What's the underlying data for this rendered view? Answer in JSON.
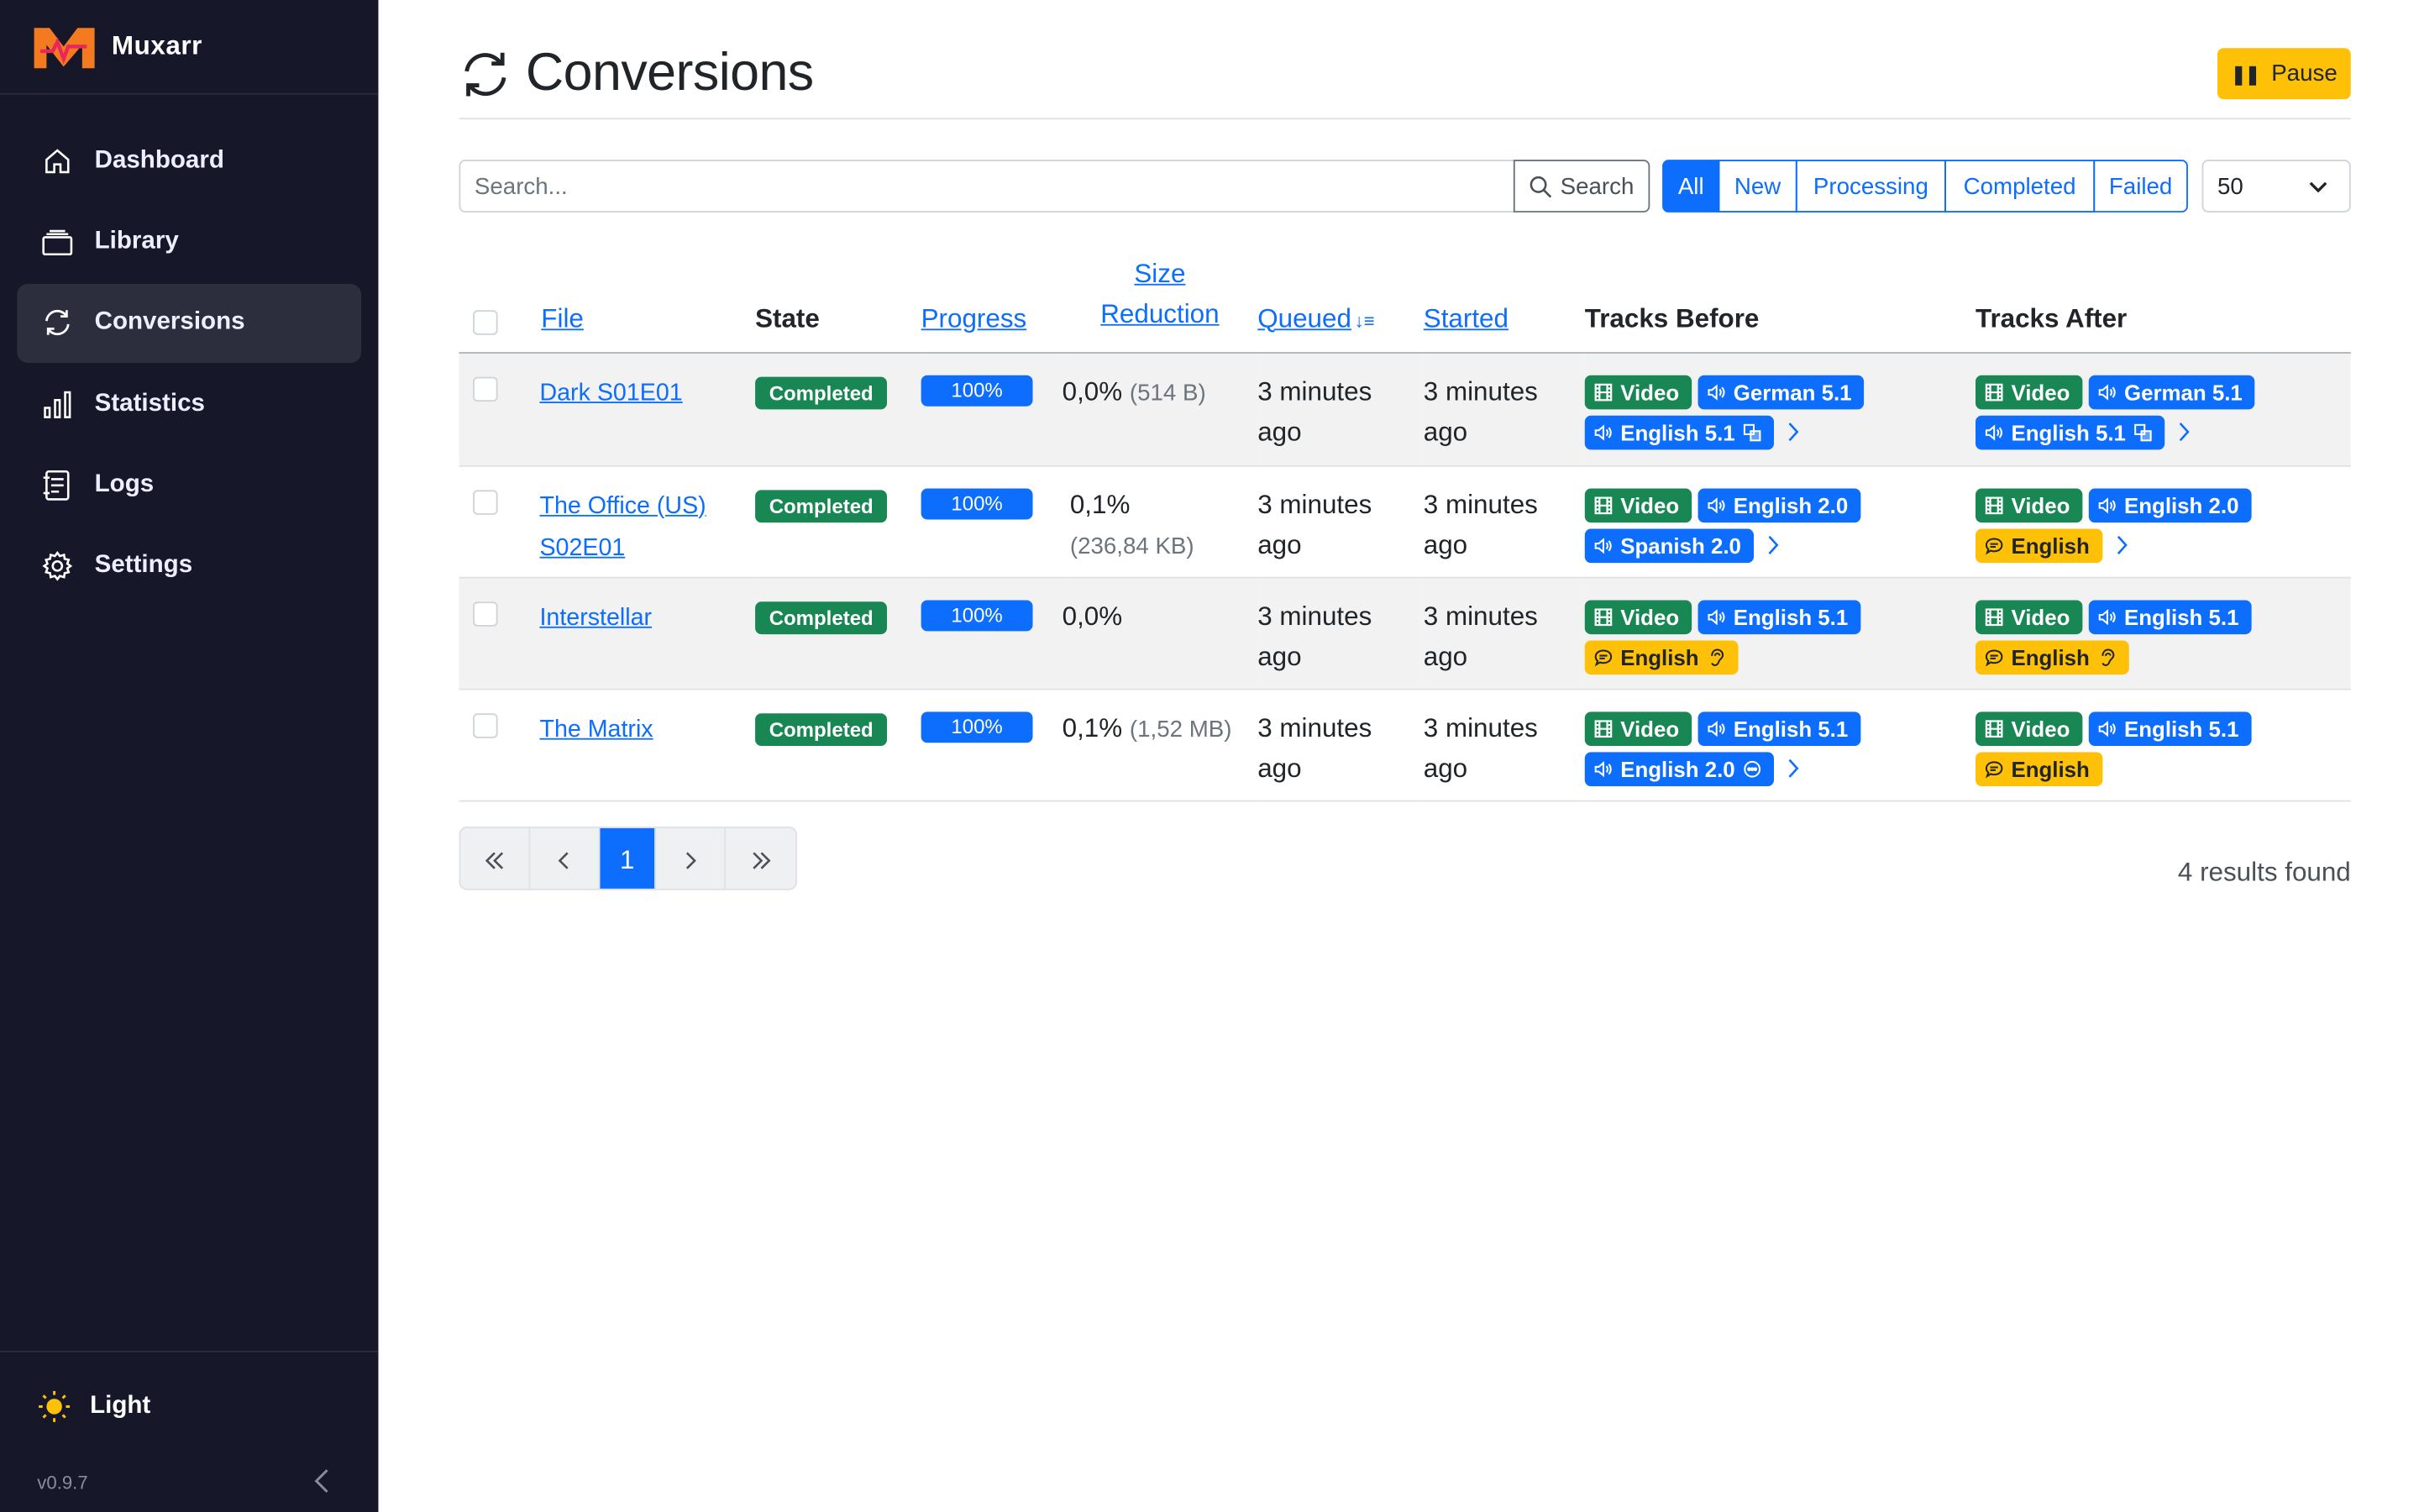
{
  "app": {
    "name": "Muxarr",
    "version": "v0.9.7",
    "theme_label": "Light"
  },
  "sidebar": {
    "items": [
      {
        "label": "Dashboard",
        "icon": "home-icon"
      },
      {
        "label": "Library",
        "icon": "library-icon"
      },
      {
        "label": "Conversions",
        "icon": "sync-icon",
        "active": true
      },
      {
        "label": "Statistics",
        "icon": "bar-chart-icon"
      },
      {
        "label": "Logs",
        "icon": "journal-icon"
      },
      {
        "label": "Settings",
        "icon": "gear-icon"
      }
    ]
  },
  "header": {
    "title": "Conversions",
    "pause_label": "Pause"
  },
  "toolbar": {
    "search_placeholder": "Search...",
    "search_button": "Search",
    "filters": [
      "All",
      "New",
      "Processing",
      "Completed",
      "Failed"
    ],
    "active_filter": "All",
    "page_size": "50"
  },
  "table": {
    "headers": {
      "file": "File",
      "state": "State",
      "progress": "Progress",
      "size_line1": "Size",
      "size_line2": "Reduction",
      "queued": "Queued",
      "started": "Started",
      "tracks_before": "Tracks Before",
      "tracks_after": "Tracks After"
    },
    "rows": [
      {
        "file_line1": "Dark S01E01",
        "file_line2": "",
        "state": "Completed",
        "progress": "100%",
        "size_pct": "0,0%",
        "size_abs": "(514 B)",
        "queued_1": "3 minutes",
        "queued_2": "ago",
        "started_1": "3 minutes",
        "started_2": "ago",
        "before": [
          {
            "type": "video",
            "label": "Video"
          },
          {
            "type": "audio",
            "label": "German 5.1"
          },
          {
            "type": "audio",
            "label": "English 5.1",
            "trail": "translate-icon"
          }
        ],
        "before_more": true,
        "after": [
          {
            "type": "video",
            "label": "Video"
          },
          {
            "type": "audio",
            "label": "German 5.1"
          },
          {
            "type": "audio",
            "label": "English 5.1",
            "trail": "translate-icon"
          }
        ],
        "after_more": true
      },
      {
        "file_line1": "The Office (US)",
        "file_line2": "S02E01",
        "state": "Completed",
        "progress": "100%",
        "size_pct": "0,1%",
        "size_abs": "(236,84 KB)",
        "queued_1": "3 minutes",
        "queued_2": "ago",
        "started_1": "3 minutes",
        "started_2": "ago",
        "before": [
          {
            "type": "video",
            "label": "Video"
          },
          {
            "type": "audio",
            "label": "English 2.0"
          },
          {
            "type": "audio",
            "label": "Spanish 2.0"
          }
        ],
        "before_more": true,
        "after": [
          {
            "type": "video",
            "label": "Video"
          },
          {
            "type": "audio",
            "label": "English 2.0"
          },
          {
            "type": "sub",
            "label": "English"
          }
        ],
        "after_more": true
      },
      {
        "file_line1": "Interstellar",
        "file_line2": "",
        "state": "Completed",
        "progress": "100%",
        "size_pct": "0,0%",
        "size_abs": "",
        "queued_1": "3 minutes",
        "queued_2": "ago",
        "started_1": "3 minutes",
        "started_2": "ago",
        "before": [
          {
            "type": "video",
            "label": "Video"
          },
          {
            "type": "audio",
            "label": "English 5.1"
          },
          {
            "type": "sub",
            "label": "English",
            "trail": "ear-icon"
          }
        ],
        "before_more": false,
        "after": [
          {
            "type": "video",
            "label": "Video"
          },
          {
            "type": "audio",
            "label": "English 5.1"
          },
          {
            "type": "sub",
            "label": "English",
            "trail": "ear-icon"
          }
        ],
        "after_more": false
      },
      {
        "file_line1": "The Matrix",
        "file_line2": "",
        "state": "Completed",
        "progress": "100%",
        "size_pct": "0,1%",
        "size_abs": "(1,52 MB)",
        "queued_1": "3 minutes",
        "queued_2": "ago",
        "started_1": "3 minutes",
        "started_2": "ago",
        "before": [
          {
            "type": "video",
            "label": "Video"
          },
          {
            "type": "audio",
            "label": "English 5.1"
          },
          {
            "type": "audio",
            "label": "English 2.0",
            "trail": "commentary-icon"
          }
        ],
        "before_more": true,
        "after": [
          {
            "type": "video",
            "label": "Video"
          },
          {
            "type": "audio",
            "label": "English 5.1"
          },
          {
            "type": "sub",
            "label": "English"
          }
        ],
        "after_more": false
      }
    ]
  },
  "pagination": {
    "current_page": "1"
  },
  "results": "4 results found",
  "colors": {
    "primary": "#0d6efd",
    "success": "#198754",
    "warning": "#ffc107",
    "sidebar": "#161728"
  }
}
